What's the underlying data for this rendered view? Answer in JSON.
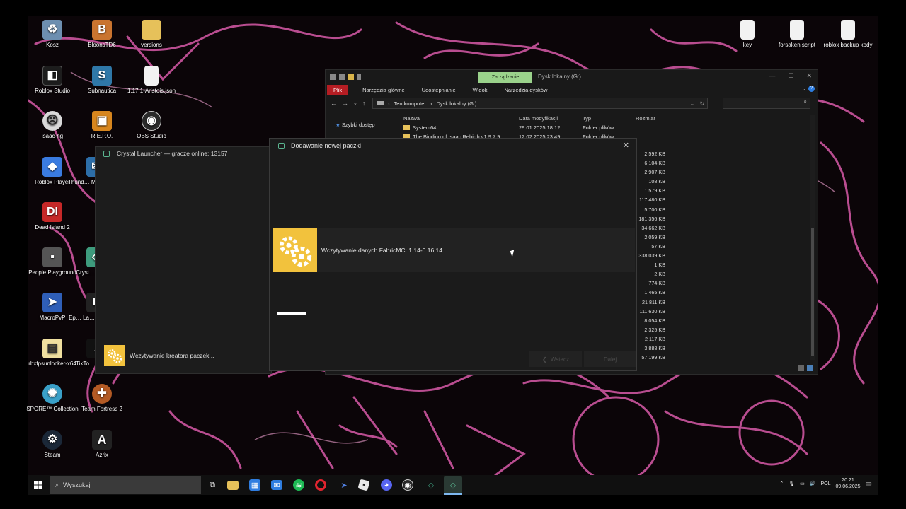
{
  "desktop": {
    "icons": [
      {
        "label": "Kosz",
        "icon": "recycle-bin-icon",
        "color": "#6d8fb0"
      },
      {
        "label": "BloonsTD6",
        "icon": "bloons-icon",
        "color": "#c9742f"
      },
      {
        "label": "versions",
        "icon": "folder-icon",
        "color": "#e6c15a"
      },
      {
        "label": "Roblox Studio",
        "icon": "roblox-studio-icon",
        "color": "#1d1d1d"
      },
      {
        "label": "Subnautica",
        "icon": "subnautica-icon",
        "color": "#2f78a8"
      },
      {
        "label": "1.17.1-Aristois.json",
        "icon": "file-icon",
        "color": "#f2f2f2"
      },
      {
        "label": "isaac-ng",
        "icon": "isaac-icon",
        "color": "#d9d9d9"
      },
      {
        "label": "R.E.P.O.",
        "icon": "repo-icon",
        "color": "#d7861e"
      },
      {
        "label": "OBS Studio",
        "icon": "obs-icon",
        "color": "#2a2a2a"
      },
      {
        "label": "Roblox Player",
        "icon": "roblox-player-icon",
        "color": "#3a7be0"
      },
      {
        "label": "Thund… M…",
        "icon": "thunderbird-icon",
        "color": "#2d6ea8"
      },
      {
        "label": "Dead Island 2",
        "icon": "dead-island-icon",
        "color": "#c62828"
      },
      {
        "label": "People Playground",
        "icon": "people-playground-icon",
        "color": "#555555"
      },
      {
        "label": "Cryst…",
        "icon": "crystal-icon",
        "color": "#3e9b7d"
      },
      {
        "label": "MacroPvP",
        "icon": "macropvp-icon",
        "color": "#2f5fb8"
      },
      {
        "label": "Ep… La…",
        "icon": "epic-icon",
        "color": "#222222"
      },
      {
        "label": "rbxfpsunlocker-x64",
        "icon": "rbxfps-icon",
        "color": "#f0e0a0"
      },
      {
        "label": "TikTo…",
        "icon": "tiktok-icon",
        "color": "#111111"
      },
      {
        "label": "SPORE™ Collection",
        "icon": "spore-icon",
        "color": "#3aa0c8"
      },
      {
        "label": "Team Fortress 2",
        "icon": "tf2-icon",
        "color": "#b35a24"
      },
      {
        "label": "Steam",
        "icon": "steam-icon",
        "color": "#1b2838"
      },
      {
        "label": "Azrix",
        "icon": "azrix-icon",
        "color": "#222222"
      },
      {
        "label": "key",
        "icon": "text-file-icon",
        "color": "#f2f2f2"
      },
      {
        "label": "forsaken script",
        "icon": "text-file-icon",
        "color": "#f2f2f2"
      },
      {
        "label": "roblox backup kody",
        "icon": "text-file-icon",
        "color": "#f2f2f2"
      }
    ]
  },
  "explorer": {
    "title": "Dysk lokalny (G:)",
    "context_tab": "Zarządzanie",
    "ribbon_tabs": [
      "Plik",
      "Narzędzia główne",
      "Udostępnianie",
      "Widok",
      "Narzędzia dysków"
    ],
    "path": [
      "Ten komputer",
      "Dysk lokalny (G:)"
    ],
    "columns": [
      "Nazwa",
      "Data modyfikacji",
      "Typ",
      "Rozmiar"
    ],
    "sidebar_item": "Szybki dostęp",
    "rows": [
      {
        "name": "System64",
        "date": "29.01.2025 18:12",
        "type": "Folder plików"
      },
      {
        "name": "The Binding of Isaac Rebirth v1.9.7.9",
        "date": "12.02.2025 23:49",
        "type": "Folder plików"
      }
    ],
    "sizes": [
      "2 592 KB",
      "6 104 KB",
      "2 907 KB",
      "108 KB",
      "1 579 KB",
      "117 480 KB",
      "5 700 KB",
      "181 356 KB",
      "34 662 KB",
      "2 059 KB",
      "57 KB",
      "338 039 KB",
      "1 KB",
      "2 KB",
      "774 KB",
      "1 465 KB",
      "21 811 KB",
      "111 630 KB",
      "8 054 KB",
      "2 325 KB",
      "2 117 KB",
      "3 888 KB",
      "57 199 KB"
    ]
  },
  "launcher": {
    "title": "Crystal Launcher — gracze online: 13157",
    "loading_text": "Wczytywanie kreatora paczek..."
  },
  "dialog": {
    "title": "Dodawanie nowej paczki",
    "status": "Wczytywanie danych FabricMC: 1.14-0.16.14",
    "back_label": "Wstecz",
    "next_label": "Dalej",
    "accent": "#f2c23d"
  },
  "taskbar": {
    "search_placeholder": "Wyszukaj",
    "language": "POL",
    "time": "20:21",
    "date": "09.06.2025"
  }
}
